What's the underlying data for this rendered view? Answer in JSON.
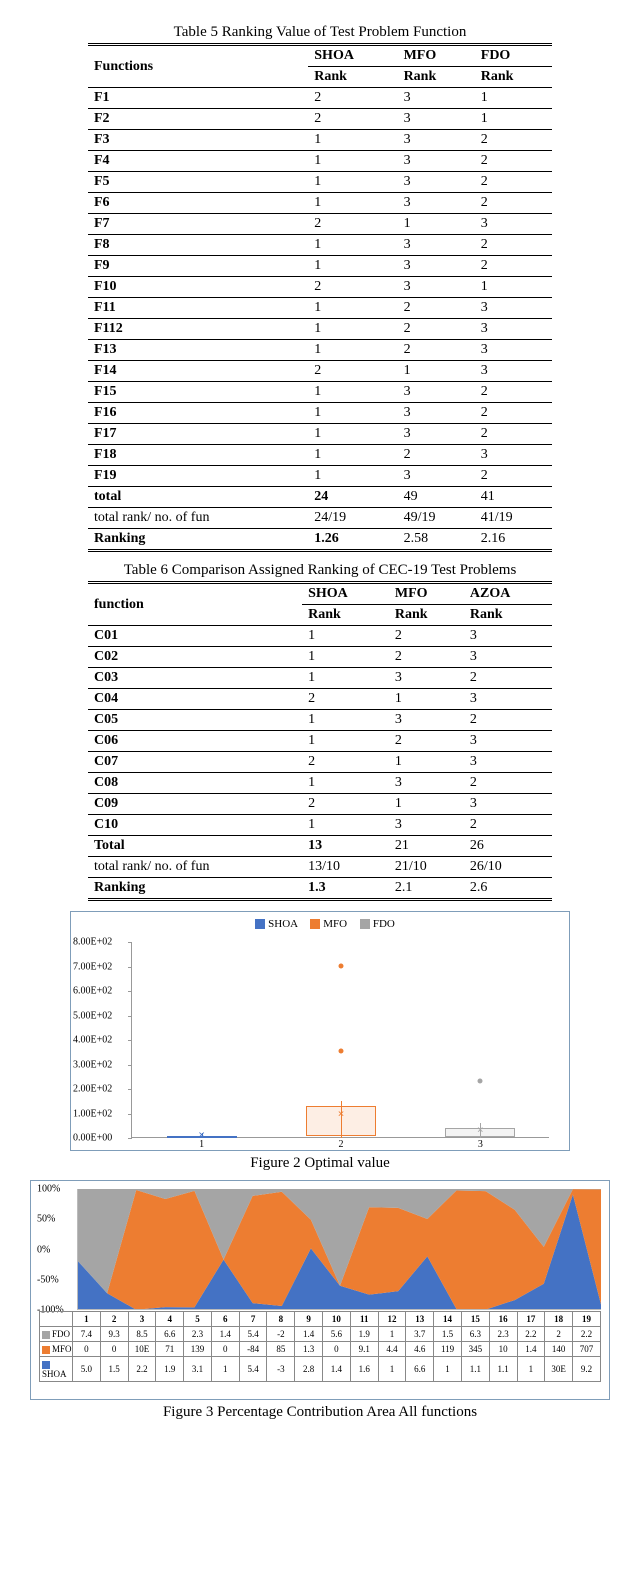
{
  "table5": {
    "caption": "Table 5 Ranking Value of Test Problem Function",
    "head_functions": "Functions",
    "algos": [
      "SHOA",
      "MFO",
      "FDO"
    ],
    "sub": "Rank",
    "rows": [
      {
        "f": "F1",
        "v": [
          2,
          3,
          1
        ]
      },
      {
        "f": "F2",
        "v": [
          2,
          3,
          1
        ]
      },
      {
        "f": "F3",
        "v": [
          1,
          3,
          2
        ]
      },
      {
        "f": "F4",
        "v": [
          1,
          3,
          2
        ]
      },
      {
        "f": "F5",
        "v": [
          1,
          3,
          2
        ]
      },
      {
        "f": "F6",
        "v": [
          1,
          3,
          2
        ]
      },
      {
        "f": "F7",
        "v": [
          2,
          1,
          3
        ]
      },
      {
        "f": "F8",
        "v": [
          1,
          3,
          2
        ]
      },
      {
        "f": "F9",
        "v": [
          1,
          3,
          2
        ]
      },
      {
        "f": "F10",
        "v": [
          2,
          3,
          1
        ]
      },
      {
        "f": "F11",
        "v": [
          1,
          2,
          3
        ]
      },
      {
        "f": "F112",
        "v": [
          1,
          2,
          3
        ]
      },
      {
        "f": "F13",
        "v": [
          1,
          2,
          3
        ]
      },
      {
        "f": "F14",
        "v": [
          2,
          1,
          3
        ]
      },
      {
        "f": "F15",
        "v": [
          1,
          3,
          2
        ]
      },
      {
        "f": "F16",
        "v": [
          1,
          3,
          2
        ]
      },
      {
        "f": "F17",
        "v": [
          1,
          3,
          2
        ]
      },
      {
        "f": "F18",
        "v": [
          1,
          2,
          3
        ]
      },
      {
        "f": "F19",
        "v": [
          1,
          3,
          2
        ]
      }
    ],
    "total_label": "total",
    "total": [
      "24",
      "49",
      "41"
    ],
    "trn_label": "total rank/ no. of fun",
    "trn": [
      "24/19",
      "49/19",
      "41/19"
    ],
    "ranking_label": "Ranking",
    "ranking": [
      "1.26",
      "2.58",
      "2.16"
    ]
  },
  "table6": {
    "caption": "Table 6 Comparison Assigned Ranking of CEC-19 Test Problems",
    "head_functions": "function",
    "algos": [
      "SHOA",
      "MFO",
      "AZOA"
    ],
    "sub": "Rank",
    "rows": [
      {
        "f": "C01",
        "v": [
          1,
          2,
          3
        ]
      },
      {
        "f": "C02",
        "v": [
          1,
          2,
          3
        ]
      },
      {
        "f": "C03",
        "v": [
          1,
          3,
          2
        ]
      },
      {
        "f": "C04",
        "v": [
          2,
          1,
          3
        ]
      },
      {
        "f": "C05",
        "v": [
          1,
          3,
          2
        ]
      },
      {
        "f": "C06",
        "v": [
          1,
          2,
          3
        ]
      },
      {
        "f": "C07",
        "v": [
          2,
          1,
          3
        ]
      },
      {
        "f": "C08",
        "v": [
          1,
          3,
          2
        ]
      },
      {
        "f": "C09",
        "v": [
          2,
          1,
          3
        ]
      },
      {
        "f": "C10",
        "v": [
          1,
          3,
          2
        ]
      }
    ],
    "total_label": "Total",
    "total": [
      "13",
      "21",
      "26"
    ],
    "trn_label": "total rank/ no. of fun",
    "trn": [
      "13/10",
      "21/10",
      "26/10"
    ],
    "ranking_label": "Ranking",
    "ranking": [
      "1.3",
      "2.1",
      "2.6"
    ]
  },
  "fig2": {
    "caption": "Figure 2 Optimal value",
    "legend": [
      "SHOA",
      "MFO",
      "FDO"
    ]
  },
  "fig3": {
    "caption": "Figure 3 Percentage Contribution Area All functions",
    "ylabels": [
      "100%",
      "50%",
      "0%",
      "-50%",
      "-100%"
    ],
    "xlabels": [
      "1",
      "2",
      "3",
      "4",
      "5",
      "6",
      "7",
      "8",
      "9",
      "10",
      "11",
      "12",
      "13",
      "14",
      "15",
      "16",
      "17",
      "18",
      "19"
    ],
    "series": [
      {
        "name": "FDO",
        "color": "c-fdo",
        "vals": [
          "7.4",
          "9.3",
          "8.5",
          "6.6",
          "2.3",
          "1.4",
          "5.4",
          "-2",
          "1.4",
          "5.6",
          "1.9",
          "1",
          "3.7",
          "1.5",
          "6.3",
          "2.3",
          "2.2",
          "2",
          "2.2"
        ]
      },
      {
        "name": "MFO",
        "color": "c-mfo",
        "vals": [
          "0",
          "0",
          "10E",
          "71",
          "139",
          "0",
          "-84",
          "85",
          "1.3",
          "0",
          "9.1",
          "4.4",
          "4.6",
          "119",
          "345",
          "10",
          "1.4",
          "140",
          "707"
        ]
      },
      {
        "name": "SHOA",
        "color": "c-shoa",
        "vals": [
          "5.0",
          "1.5",
          "2.2",
          "1.9",
          "3.1",
          "1",
          "5.4",
          "-3",
          "2.8",
          "1.4",
          "1.6",
          "1",
          "6.6",
          "1",
          "1.1",
          "1.1",
          "1",
          "30E",
          "9.2"
        ]
      }
    ]
  },
  "chart_data": [
    {
      "type": "box",
      "title": "Figure 2 Optimal value",
      "categories": [
        "SHOA",
        "MFO",
        "FDO"
      ],
      "ylim": [
        0,
        800
      ],
      "yticks": [
        "0.00E+00",
        "1.00E+02",
        "2.00E+02",
        "3.00E+02",
        "4.00E+02",
        "5.00E+02",
        "6.00E+02",
        "7.00E+02",
        "8.00E+02"
      ],
      "xticks": [
        "1",
        "2",
        "3"
      ],
      "series": [
        {
          "name": "SHOA",
          "color": "#4472C4",
          "box": {
            "q1": 0,
            "median": 5,
            "q3": 10,
            "min": 0,
            "max": 20
          },
          "outliers": [],
          "mean": 7
        },
        {
          "name": "MFO",
          "color": "#ED7D31",
          "box": {
            "q1": 10,
            "median": 50,
            "q3": 130,
            "min": 0,
            "max": 150
          },
          "outliers": [
            350,
            700
          ],
          "mean": 95
        },
        {
          "name": "FDO",
          "color": "#A5A5A5",
          "box": {
            "q1": 5,
            "median": 20,
            "q3": 40,
            "min": 0,
            "max": 60
          },
          "outliers": [
            230
          ],
          "mean": 30
        }
      ]
    },
    {
      "type": "area",
      "title": "Figure 3 Percentage Contribution Area All functions",
      "x": [
        1,
        2,
        3,
        4,
        5,
        6,
        7,
        8,
        9,
        10,
        11,
        12,
        13,
        14,
        15,
        16,
        17,
        18,
        19
      ],
      "ylim": [
        -100,
        100
      ],
      "stack": "percent",
      "series": [
        {
          "name": "FDO",
          "color": "#A5A5A5",
          "values": [
            7.4,
            9.3,
            8.5,
            6.6,
            2.3,
            1.4,
            5.4,
            -2,
            1.4,
            5.6,
            1.9,
            1,
            3.7,
            1.5,
            6.3,
            2.3,
            2.2,
            2,
            2.2
          ]
        },
        {
          "name": "MFO",
          "color": "#ED7D31",
          "values": [
            0,
            0,
            1000,
            71,
            139,
            0,
            -84,
            85,
            1.3,
            0,
            9.1,
            4.4,
            4.6,
            119,
            345,
            10,
            1.4,
            140,
            707
          ]
        },
        {
          "name": "SHOA",
          "color": "#4472C4",
          "values": [
            5.0,
            1.5,
            2.2,
            1.9,
            3.1,
            1,
            5.4,
            -3,
            2.8,
            1.4,
            1.6,
            1,
            6.6,
            1,
            1.1,
            1.1,
            1,
            3000,
            9.2
          ]
        }
      ]
    }
  ]
}
